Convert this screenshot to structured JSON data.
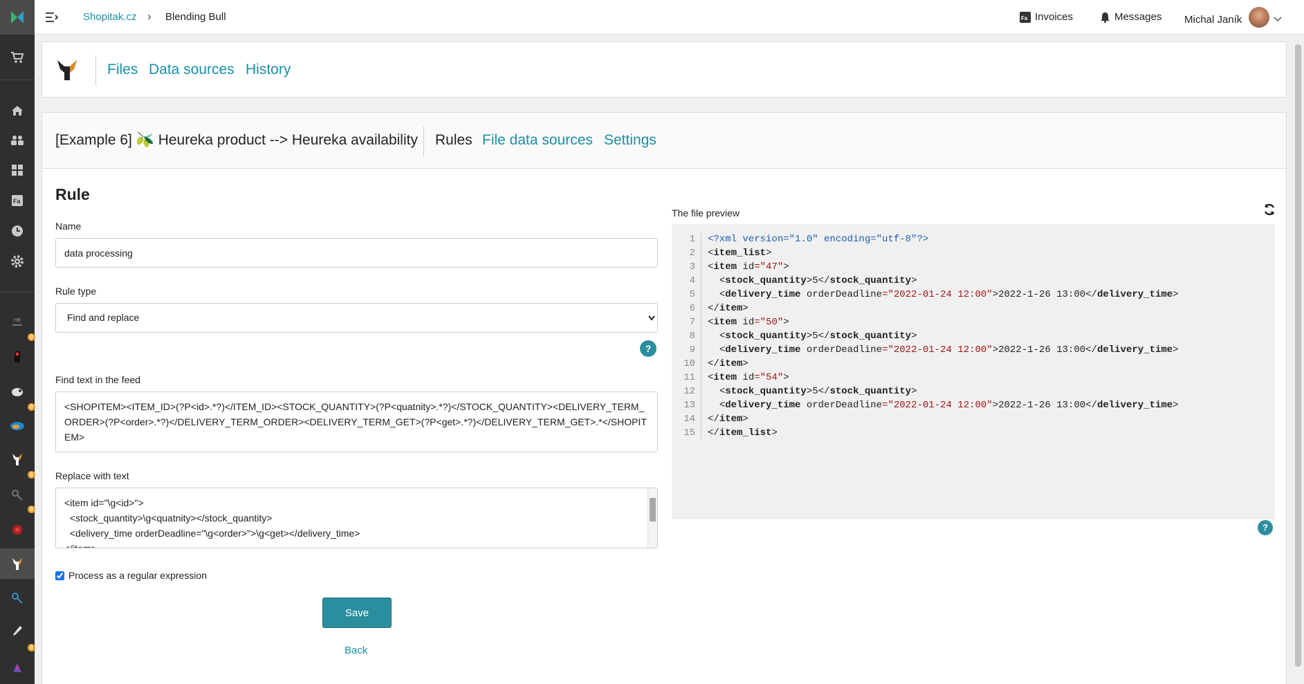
{
  "topbar": {
    "breadcrumb_root": "Shopitak.cz",
    "breadcrumb_sep": "›",
    "breadcrumb_current": "Blending Bull",
    "invoices": "Invoices",
    "messages": "Messages",
    "user_name": "Michal Janík"
  },
  "sidebar": {
    "badge": "0",
    "hb_label": "HB"
  },
  "nav": {
    "files": "Files",
    "data_sources": "Data sources",
    "history": "History"
  },
  "file": {
    "title": "[Example 6] 🫒 Heureka product --> Heureka availability",
    "tab_rules": "Rules",
    "tab_file_data_sources": "File data sources",
    "tab_settings": "Settings"
  },
  "form": {
    "heading": "Rule",
    "name_label": "Name",
    "name_value": "data processing",
    "rule_type_label": "Rule type",
    "rule_type_value": "Find and replace",
    "find_label": "Find text in the feed",
    "find_value": "<SHOPITEM><ITEM_ID>(?P<id>.*?)</ITEM_ID><STOCK_QUANTITY>(?P<quatnity>.*?)</STOCK_QUANTITY><DELIVERY_TERM_ORDER>(?P<order>.*?)</DELIVERY_TERM_ORDER><DELIVERY_TERM_GET>(?P<get>.*?)</DELIVERY_TERM_GET>.*</SHOPITEM>",
    "replace_label": "Replace with text",
    "replace_value": "<item id=\"\\g<id>\">\n  <stock_quantity>\\g<quatnity></stock_quantity>\n  <delivery_time orderDeadline=\"\\g<order>\">\\g<get></delivery_time>\n</item>",
    "regex_label": "Process as a regular expression",
    "save": "Save",
    "back": "Back",
    "help": "?"
  },
  "preview": {
    "label": "The file preview",
    "line_numbers": "1\n2\n3\n4\n5\n6\n7\n8\n9\n10\n11\n12\n13\n14\n15",
    "xml_decl": "<?xml version=\"1.0\" encoding=\"utf-8\"?>",
    "lines": [
      {
        "indent": "",
        "open": "item_list"
      },
      {
        "indent": "",
        "open": "item",
        "attr": "id",
        "val": "47"
      },
      {
        "indent": "  ",
        "open": "stock_quantity",
        "text": "5",
        "close": "stock_quantity"
      },
      {
        "indent": "  ",
        "open": "delivery_time",
        "attr": "orderDeadline",
        "val": "2022-01-24 12:00",
        "text": "2022-1-26 13:00",
        "close": "delivery_time"
      },
      {
        "indent": "",
        "close": "item"
      },
      {
        "indent": "",
        "open": "item",
        "attr": "id",
        "val": "50"
      },
      {
        "indent": "  ",
        "open": "stock_quantity",
        "text": "5",
        "close": "stock_quantity"
      },
      {
        "indent": "  ",
        "open": "delivery_time",
        "attr": "orderDeadline",
        "val": "2022-01-24 12:00",
        "text": "2022-1-26 13:00",
        "close": "delivery_time"
      },
      {
        "indent": "",
        "close": "item"
      },
      {
        "indent": "",
        "open": "item",
        "attr": "id",
        "val": "54"
      },
      {
        "indent": "  ",
        "open": "stock_quantity",
        "text": "5",
        "close": "stock_quantity"
      },
      {
        "indent": "  ",
        "open": "delivery_time",
        "attr": "orderDeadline",
        "val": "2022-01-24 12:00",
        "text": "2022-1-26 13:00",
        "close": "delivery_time"
      },
      {
        "indent": "",
        "close": "item"
      },
      {
        "indent": "",
        "close": "item_list"
      }
    ]
  },
  "colors": {
    "accent": "#1a8fa6",
    "button": "#2b8e9e",
    "sidebar": "#2f2f2f",
    "badge": "#f0a030"
  }
}
